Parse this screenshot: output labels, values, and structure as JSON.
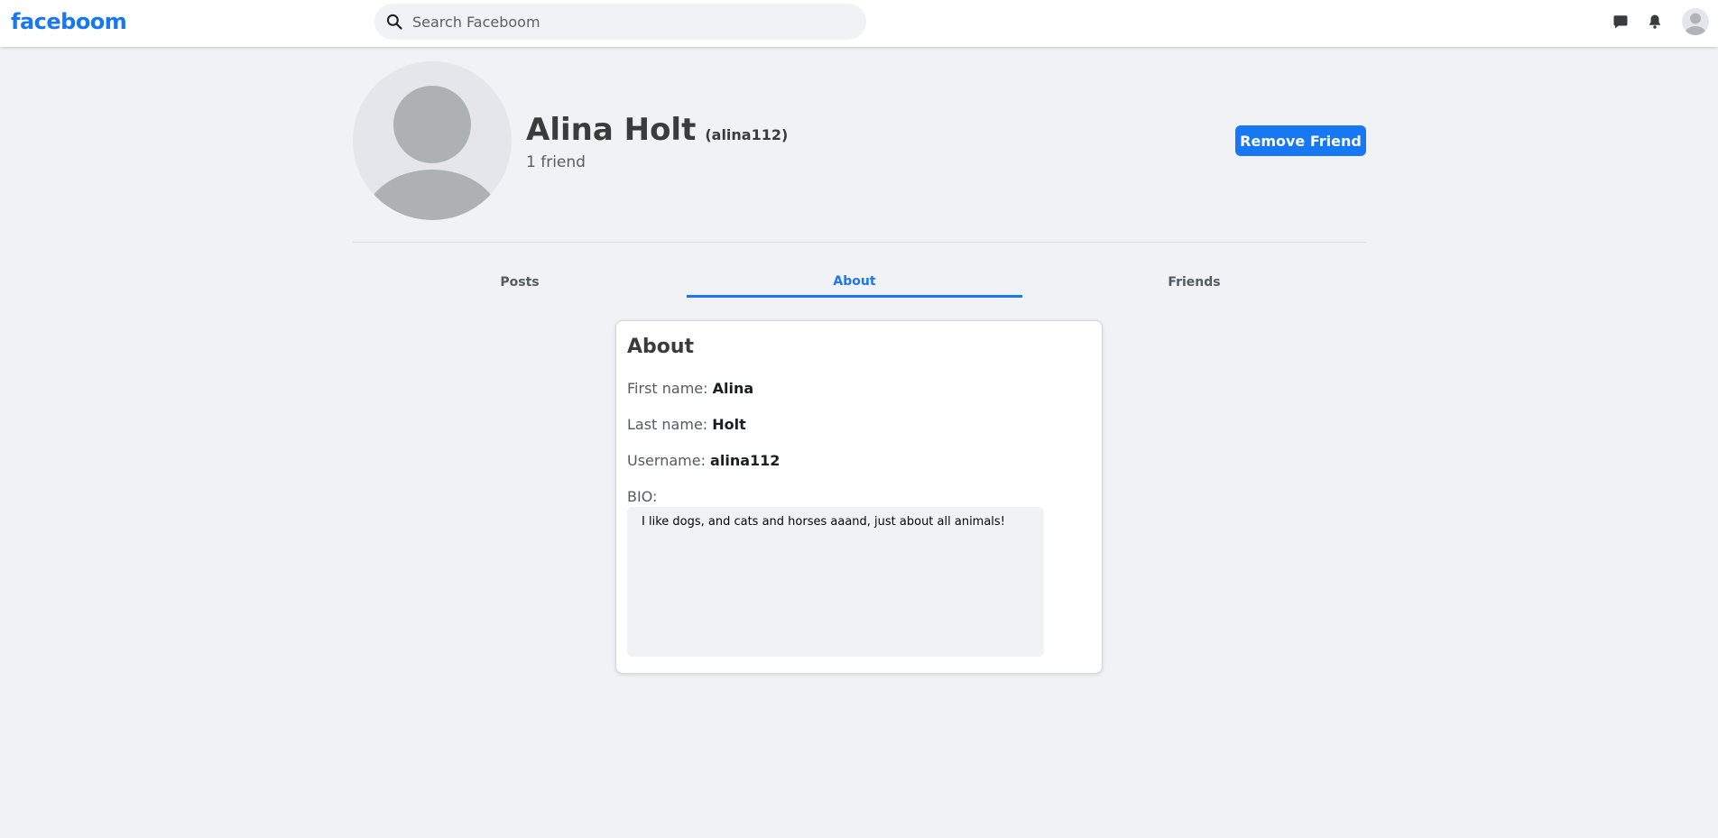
{
  "app": {
    "logo": "faceboom"
  },
  "search": {
    "placeholder": "Search Faceboom",
    "value": ""
  },
  "nav": {
    "icons": [
      "messenger-icon",
      "bell-icon",
      "avatar"
    ]
  },
  "colors": {
    "brand": "#1877f2",
    "background": "#f0f2f5",
    "surface": "#ffffff"
  },
  "profile": {
    "name": "Alina Holt",
    "username": "(alina112)",
    "friend_count": "1 friend",
    "action_button": "Remove Friend"
  },
  "tabs": [
    {
      "label": "Posts",
      "active": false
    },
    {
      "label": "About",
      "active": true
    },
    {
      "label": "Friends",
      "active": false
    }
  ],
  "about": {
    "title": "About",
    "fields": [
      {
        "label": "First name:",
        "value": "Alina"
      },
      {
        "label": "Last name:",
        "value": "Holt"
      },
      {
        "label": "Username:",
        "value": "alina112"
      }
    ],
    "bio_label": "BIO:",
    "bio": "I like dogs, and cats and horses aaand, just about all animals!"
  }
}
